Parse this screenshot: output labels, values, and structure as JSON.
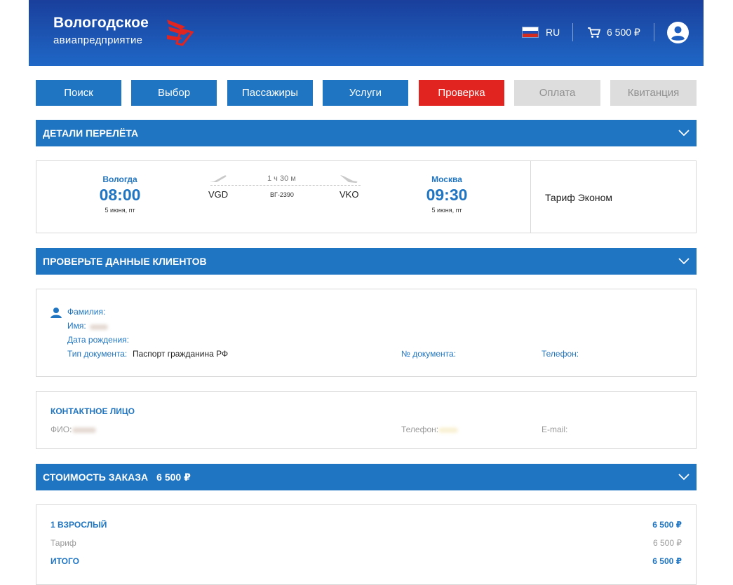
{
  "header": {
    "logo_title": "Вологодское",
    "logo_subtitle": "авиапредприятие",
    "language": "RU",
    "cart_total": "6 500 ₽",
    "colors": {
      "header_top": "#1a3f9c",
      "header_bottom": "#1f67c6",
      "logo_red": "#e1241f"
    },
    "icons": [
      "logo-wing-icon",
      "russia-flag-icon",
      "cart-icon",
      "user-account-icon"
    ]
  },
  "steps": [
    {
      "label": "Поиск",
      "state": "done"
    },
    {
      "label": "Выбор",
      "state": "done"
    },
    {
      "label": "Пассажиры",
      "state": "done"
    },
    {
      "label": "Услуги",
      "state": "done"
    },
    {
      "label": "Проверка",
      "state": "active"
    },
    {
      "label": "Оплата",
      "state": "disabled"
    },
    {
      "label": "Квитанция",
      "state": "disabled"
    }
  ],
  "flight_section": {
    "title": "ДЕТАЛИ ПЕРЕЛЁТА",
    "departure": {
      "city": "Вологда",
      "time": "08:00",
      "date": "5 июня, пт",
      "code": "VGD"
    },
    "duration": "1 ч 30 м",
    "flight_number": "ВГ-2390",
    "arrival": {
      "city": "Москва",
      "time": "09:30",
      "date": "5 июня, пт",
      "code": "VKO"
    },
    "tariff": "Тариф Эконом"
  },
  "clients_section": {
    "title": "ПРОВЕРЬТЕ ДАННЫЕ КЛИЕНТОВ",
    "passenger": {
      "surname_label": "Фамилия:",
      "name_label": "Имя:",
      "birth_label": "Дата рождения:",
      "doc_type_label": "Тип документа:",
      "doc_type_value": "Паспорт гражданина РФ",
      "doc_number_label": "№ документа:",
      "phone_label": "Телефон:"
    },
    "contact": {
      "title": "КОНТАКТНОЕ ЛИЦО",
      "fio_label": "ФИО:",
      "phone_label": "Телефон:",
      "email_label": "E-mail:"
    }
  },
  "cost_section": {
    "title": "СТОИМОСТЬ ЗАКАЗА",
    "total": "6 500 ₽",
    "rows": [
      {
        "label": "1 ВЗРОСЛЫЙ",
        "value": "6 500 ₽",
        "style": "bold"
      },
      {
        "label": "Тариф",
        "value": "6 500 ₽",
        "style": "muted"
      },
      {
        "label": "ИТОГО",
        "value": "6 500 ₽",
        "style": "bold"
      }
    ]
  }
}
